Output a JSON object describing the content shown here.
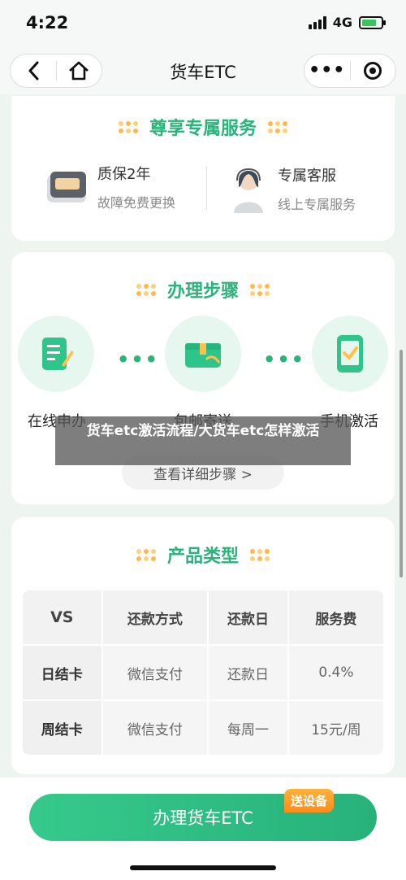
{
  "status": {
    "time": "4:22",
    "network": "4G",
    "battery_level": 0.75
  },
  "nav": {
    "title": "货车ETC",
    "icons": {
      "back": "chevron-left-icon",
      "home": "home-icon",
      "more": "more-icon",
      "close": "target-icon"
    }
  },
  "service": {
    "title": "尊享专属服务",
    "features": [
      {
        "title": "质保2年",
        "subtitle": "故障免费更换",
        "icon": "device-icon"
      },
      {
        "title": "专属客服",
        "subtitle": "线上专属服务",
        "icon": "agent-icon"
      }
    ]
  },
  "steps": {
    "title": "办理步骤",
    "items": [
      {
        "label": "在线申办",
        "icon": "document-edit-icon"
      },
      {
        "label": "包邮寄送",
        "icon": "box-icon"
      },
      {
        "label": "手机激活",
        "icon": "phone-check-icon"
      }
    ],
    "detail_button": "查看详细步骤 >"
  },
  "products": {
    "title": "产品类型",
    "headers": [
      "VS",
      "还款方式",
      "还款日",
      "服务费"
    ],
    "rows": [
      [
        "日结卡",
        "微信支付",
        "还款日",
        "0.4%"
      ],
      [
        "周结卡",
        "微信支付",
        "每周一",
        "15元/周"
      ]
    ]
  },
  "caption": "货车etc激活流程/大货车etc怎样激活",
  "cta": {
    "label": "办理货车ETC",
    "badge": "送设备"
  },
  "colors": {
    "accent": "#2bb37a",
    "badge": "#ff9a26",
    "vs_header": "#fbe6b3"
  }
}
